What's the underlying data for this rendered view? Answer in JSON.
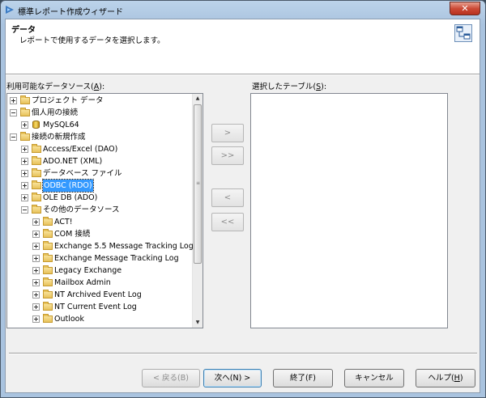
{
  "window": {
    "title": "標準レポート作成ウィザード"
  },
  "header": {
    "title": "データ",
    "subtitle": "レポートで使用するデータを選択します。",
    "icon": "data-wizard-icon"
  },
  "available": {
    "label": "利用可能なデータソース(",
    "accel": "A",
    "label_end": "):",
    "tree": [
      {
        "label": "プロジェクト データ",
        "expander": "plus",
        "icon": "folder"
      },
      {
        "label": "個人用の接続",
        "expander": "minus",
        "icon": "folder"
      },
      {
        "label": "MySQL64",
        "expander": "plus",
        "icon": "database"
      },
      {
        "label": "接続の新規作成",
        "expander": "minus",
        "icon": "folder"
      },
      {
        "label": "Access/Excel (DAO)",
        "expander": "plus",
        "icon": "folder"
      },
      {
        "label": "ADO.NET (XML)",
        "expander": "plus",
        "icon": "folder"
      },
      {
        "label": "データベース ファイル",
        "expander": "plus",
        "icon": "folder"
      },
      {
        "label": "ODBC (RDO)",
        "expander": "plus",
        "icon": "folder",
        "selected": true
      },
      {
        "label": "OLE DB (ADO)",
        "expander": "plus",
        "icon": "folder"
      },
      {
        "label": "その他のデータソース",
        "expander": "minus",
        "icon": "folder"
      },
      {
        "label": "ACT!",
        "expander": "plus",
        "icon": "folder"
      },
      {
        "label": "COM 接続",
        "expander": "plus",
        "icon": "folder"
      },
      {
        "label": "Exchange 5.5 Message Tracking Log",
        "expander": "plus",
        "icon": "folder"
      },
      {
        "label": "Exchange Message Tracking Log",
        "expander": "plus",
        "icon": "folder"
      },
      {
        "label": "Legacy Exchange",
        "expander": "plus",
        "icon": "folder"
      },
      {
        "label": "Mailbox Admin",
        "expander": "plus",
        "icon": "folder"
      },
      {
        "label": "NT Archived Event Log",
        "expander": "plus",
        "icon": "folder"
      },
      {
        "label": "NT Current Event Log",
        "expander": "plus",
        "icon": "folder"
      },
      {
        "label": "Outlook",
        "expander": "plus",
        "icon": "folder"
      }
    ]
  },
  "selected": {
    "label": "選択したテーブル(",
    "accel": "S",
    "label_end": "):"
  },
  "move_buttons": {
    "add": ">",
    "add_all": ">>",
    "remove": "<",
    "remove_all": "<<"
  },
  "buttons": {
    "back": "< 戻る(B)",
    "next": "次へ(N) >",
    "finish": "終了(F)",
    "cancel": "キャンセル",
    "help_pre": "ヘルプ(",
    "help_accel": "H",
    "help_post": ")"
  }
}
